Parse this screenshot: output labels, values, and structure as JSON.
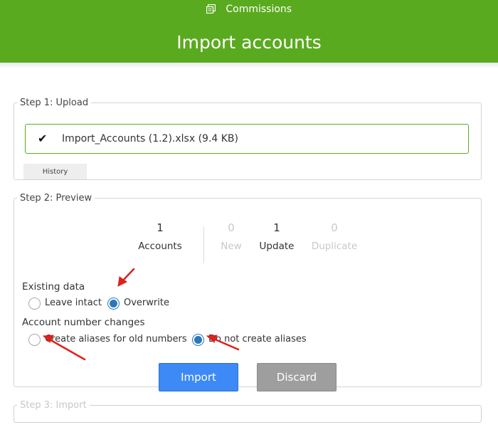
{
  "header": {
    "breadcrumb": "Commissions",
    "breadcrumb_icon": "commissions-icon",
    "title": "Import accounts",
    "brand_color": "#5aaa1f"
  },
  "step1": {
    "legend": "Step 1: Upload",
    "file": "Import_Accounts (1.2).xlsx (9.4 KB)",
    "check": "✔",
    "history_label": "History"
  },
  "step2": {
    "legend": "Step 2: Preview",
    "stats": [
      {
        "num": "1",
        "label": "Accounts"
      },
      {
        "num": "0",
        "label": "New"
      },
      {
        "num": "1",
        "label": "Update"
      },
      {
        "num": "0",
        "label": "Duplicate"
      }
    ],
    "existing": {
      "label": "Existing data",
      "options": [
        "Leave intact",
        "Overwrite"
      ],
      "selected": "Overwrite"
    },
    "account_changes": {
      "label": "Account number changes",
      "options": [
        "Create aliases for old numbers",
        "Do not create aliases"
      ],
      "selected": "Do not create aliases"
    },
    "import_label": "Import",
    "discard_label": "Discard"
  },
  "step3": {
    "legend": "Step 3: Import"
  },
  "colors": {
    "accent_green": "#5aaa1f",
    "primary_button": "#3d8af7",
    "radio_selected": "#2a78bb",
    "annotation_arrow": "#e0201b"
  }
}
